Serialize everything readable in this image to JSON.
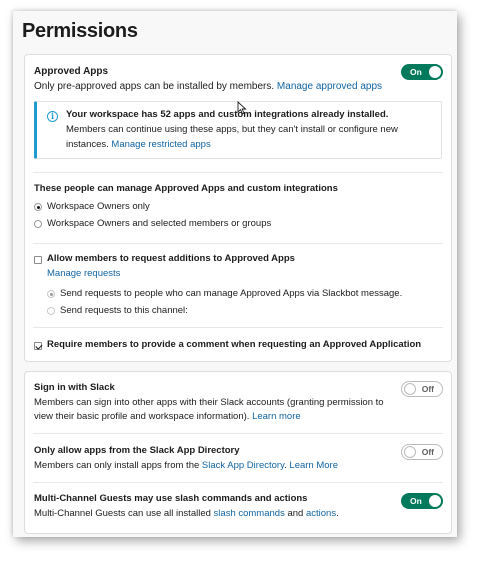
{
  "page_title": "Permissions",
  "approved_apps": {
    "title": "Approved Apps",
    "description": "Only pre-approved apps can be installed by members.",
    "link": "Manage approved apps",
    "toggle_label": "On",
    "toggle_state": "on"
  },
  "info_box": {
    "icon": "info-icon",
    "headline": "Your workspace has 52 apps and custom integrations already installed.",
    "body_line1": "Members can continue using these apps, but they can't install or configure new",
    "body_line2": "instances.",
    "link": "Manage restricted apps"
  },
  "managers": {
    "heading": "These people can manage Approved Apps and custom integrations",
    "options": [
      {
        "label": "Workspace Owners only",
        "selected": true
      },
      {
        "label": "Workspace Owners and selected members or groups",
        "selected": false
      }
    ]
  },
  "requests": {
    "checkbox_label": "Allow members to request additions to Approved Apps",
    "checked": false,
    "manage_link": "Manage requests",
    "options": [
      {
        "label": "Send requests to people who can manage Approved Apps via Slackbot message.",
        "selected": true
      },
      {
        "label": "Send requests to this channel:",
        "selected": false
      }
    ]
  },
  "require_comment": {
    "label": "Require members to provide a comment when requesting an Approved Application",
    "checked": true
  },
  "sign_in": {
    "title": "Sign in with Slack",
    "line1": "Members can sign into other apps with their Slack accounts (granting permission to",
    "line2_prefix": "view their basic profile and workspace information).",
    "link": "Learn more",
    "toggle_label": "Off",
    "toggle_state": "off"
  },
  "directory_only": {
    "title": "Only allow apps from the Slack App Directory",
    "prefix": "Members can only install apps from the",
    "link1": "Slack App Directory",
    "sep": ".",
    "link2": "Learn More",
    "toggle_label": "Off",
    "toggle_state": "off"
  },
  "guests": {
    "title": "Multi-Channel Guests may use slash commands and actions",
    "prefix": "Multi-Channel Guests can use all installed",
    "link1": "slash commands",
    "mid": "and",
    "link2": "actions",
    "suffix": ".",
    "toggle_label": "On",
    "toggle_state": "on"
  },
  "colors": {
    "toggle_on": "#007a5a",
    "link": "#1264a3",
    "info_accent": "#1d9bd1"
  }
}
